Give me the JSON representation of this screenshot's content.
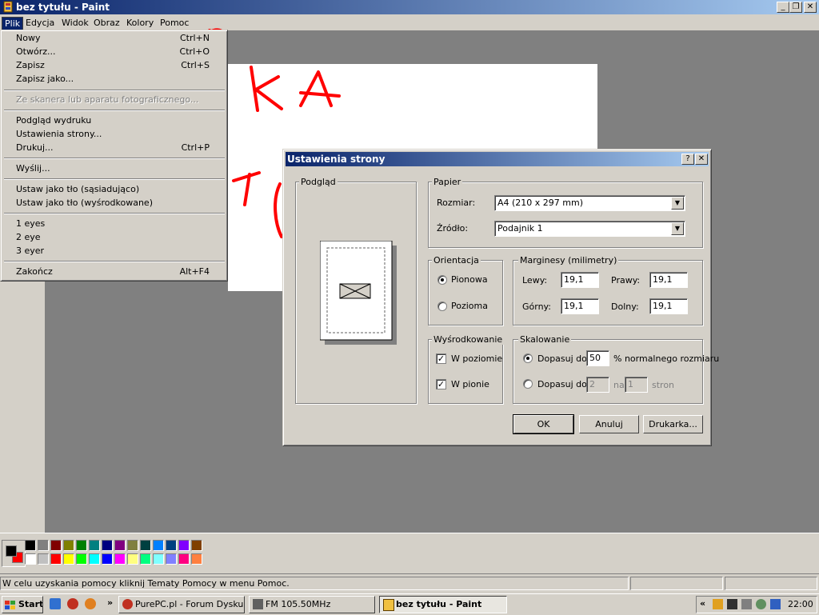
{
  "window": {
    "title": "bez tytułu - Paint",
    "min_glyph": "_",
    "max_glyph": "❐",
    "close_glyph": "✕"
  },
  "menubar": {
    "items": [
      "Plik",
      "Edycja",
      "Widok",
      "Obraz",
      "Kolory",
      "Pomoc"
    ]
  },
  "file_menu": {
    "items": [
      {
        "label": "Nowy",
        "shortcut": "Ctrl+N"
      },
      {
        "label": "Otwórz...",
        "shortcut": "Ctrl+O"
      },
      {
        "label": "Zapisz",
        "shortcut": "Ctrl+S"
      },
      {
        "label": "Zapisz jako...",
        "shortcut": ""
      },
      {
        "label": "Ze skanera lub aparatu fotograficznego...",
        "shortcut": ""
      },
      {
        "label": "Podgląd wydruku",
        "shortcut": ""
      },
      {
        "label": "Ustawienia strony...",
        "shortcut": ""
      },
      {
        "label": "Drukuj...",
        "shortcut": "Ctrl+P"
      },
      {
        "label": "Wyślij...",
        "shortcut": ""
      },
      {
        "label": "Ustaw jako tło (sąsiadująco)",
        "shortcut": ""
      },
      {
        "label": "Ustaw jako tło (wyśrodkowane)",
        "shortcut": ""
      },
      {
        "label": "1 eyes",
        "shortcut": ""
      },
      {
        "label": "2 eye",
        "shortcut": ""
      },
      {
        "label": "3 eyer",
        "shortcut": ""
      },
      {
        "label": "Zakończ",
        "shortcut": "Alt+F4"
      }
    ]
  },
  "annotation": {
    "text_top": "TU P",
    "text_canvas_1": "KA",
    "text_canvas_2": "T(",
    "color": "#ff0000"
  },
  "dialog": {
    "title": "Ustawienia strony",
    "help_glyph": "?",
    "close_glyph": "✕",
    "preview_label": "Podgląd",
    "paper": {
      "label": "Papier",
      "size_label": "Rozmiar:",
      "size_value": "A4 (210 x 297 mm)",
      "source_label": "Źródło:",
      "source_value": "Podajnik 1"
    },
    "orientation": {
      "label": "Orientacja",
      "portrait": "Pionowa",
      "landscape": "Pozioma",
      "selected": "portrait"
    },
    "margins": {
      "label": "Marginesy (milimetry)",
      "left_label": "Lewy:",
      "left": "19,1",
      "right_label": "Prawy:",
      "right": "19,1",
      "top_label": "Górny:",
      "top": "19,1",
      "bottom_label": "Dolny:",
      "bottom": "19,1"
    },
    "centering": {
      "label": "Wyśrodkowanie",
      "horizontal": "W poziomie",
      "vertical": "W pionie",
      "horizontal_checked": true,
      "vertical_checked": true
    },
    "scaling": {
      "label": "Skalowanie",
      "adjust_label": "Dopasuj do:",
      "percent_value": "50",
      "percent_suffix": "% normalnego rozmiaru",
      "fit_label": "Dopasuj do:",
      "fit_wide": "2",
      "fit_by": "na",
      "fit_tall": "1",
      "fit_suffix": "stron"
    },
    "buttons": {
      "ok": "OK",
      "cancel": "Anuluj",
      "printer": "Drukarka..."
    }
  },
  "palette": {
    "foreground": "#000000",
    "background": "#ff0000",
    "row1": [
      "#000000",
      "#808080",
      "#800000",
      "#808000",
      "#008000",
      "#008080",
      "#000080",
      "#800080",
      "#808040",
      "#004040",
      "#0080ff",
      "#004080",
      "#8000ff",
      "#804000"
    ],
    "row2": [
      "#ffffff",
      "#c0c0c0",
      "#ff0000",
      "#ffff00",
      "#00ff00",
      "#00ffff",
      "#0000ff",
      "#ff00ff",
      "#ffff80",
      "#00ff80",
      "#80ffff",
      "#8080ff",
      "#ff0080",
      "#ff8040"
    ]
  },
  "statusbar": {
    "text": "W celu uzyskania pomocy kliknij Tematy Pomocy w menu Pomoc."
  },
  "taskbar": {
    "start": "Start",
    "more_glyph": "»",
    "tasks": [
      {
        "label": "PurePC.pl - Forum Dysku...",
        "active": false
      },
      {
        "label": "FM 105.50MHz",
        "active": false
      },
      {
        "label": "bez tytułu - Paint",
        "active": true
      }
    ],
    "tray_more_glyph": "«",
    "clock": "22:00"
  }
}
